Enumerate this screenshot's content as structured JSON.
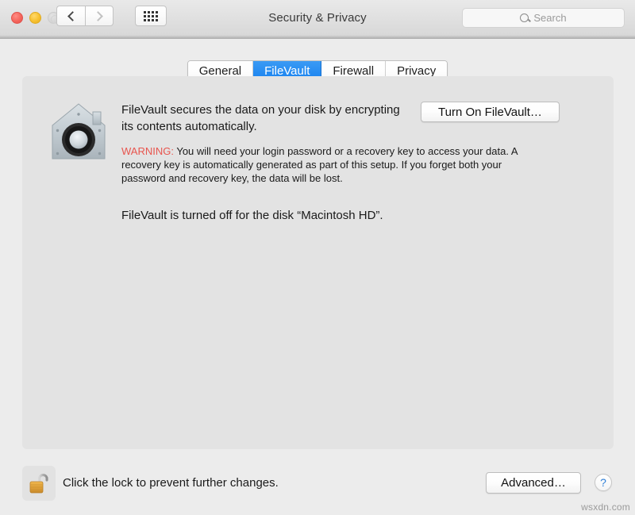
{
  "window": {
    "title": "Security & Privacy",
    "traffic_lights": [
      {
        "name": "close",
        "color": "#f5655c"
      },
      {
        "name": "minimize",
        "color": "#f7c02f"
      },
      {
        "name": "zoom",
        "color": "#d6d6d6",
        "disabled": true
      }
    ],
    "nav": {
      "back_label": "Back",
      "forward_label": "Forward",
      "show_all_label": "Show All"
    }
  },
  "search": {
    "placeholder": "Search",
    "value": "",
    "icon": "search-icon"
  },
  "tabs": [
    {
      "label": "General",
      "active": false
    },
    {
      "label": "FileVault",
      "active": true
    },
    {
      "label": "Firewall",
      "active": false
    },
    {
      "label": "Privacy",
      "active": false
    }
  ],
  "panel": {
    "icon": "filevault-house-safe-icon",
    "description": "FileVault secures the data on your disk by encrypting its contents automatically.",
    "warning_label": "WARNING:",
    "warning_text": " You will need your login password or a recovery key to access your data. A recovery key is automatically generated as part of this setup. If you forget both your password and recovery key, the data will be lost.",
    "status": "FileVault is turned off for the disk “Macintosh HD”.",
    "turn_on_button": "Turn On FileVault…"
  },
  "footer": {
    "lock_icon": "open-padlock-icon",
    "lock_text": "Click the lock to prevent further changes.",
    "advanced_button": "Advanced…",
    "help_button": "?"
  },
  "watermark": "wsxdn.com",
  "colors": {
    "accent_blue": "#1580ef",
    "warning_red": "#e8554e",
    "window_bg": "#ececec",
    "panel_bg": "#e3e3e3",
    "help_blue": "#2f7fd8"
  }
}
